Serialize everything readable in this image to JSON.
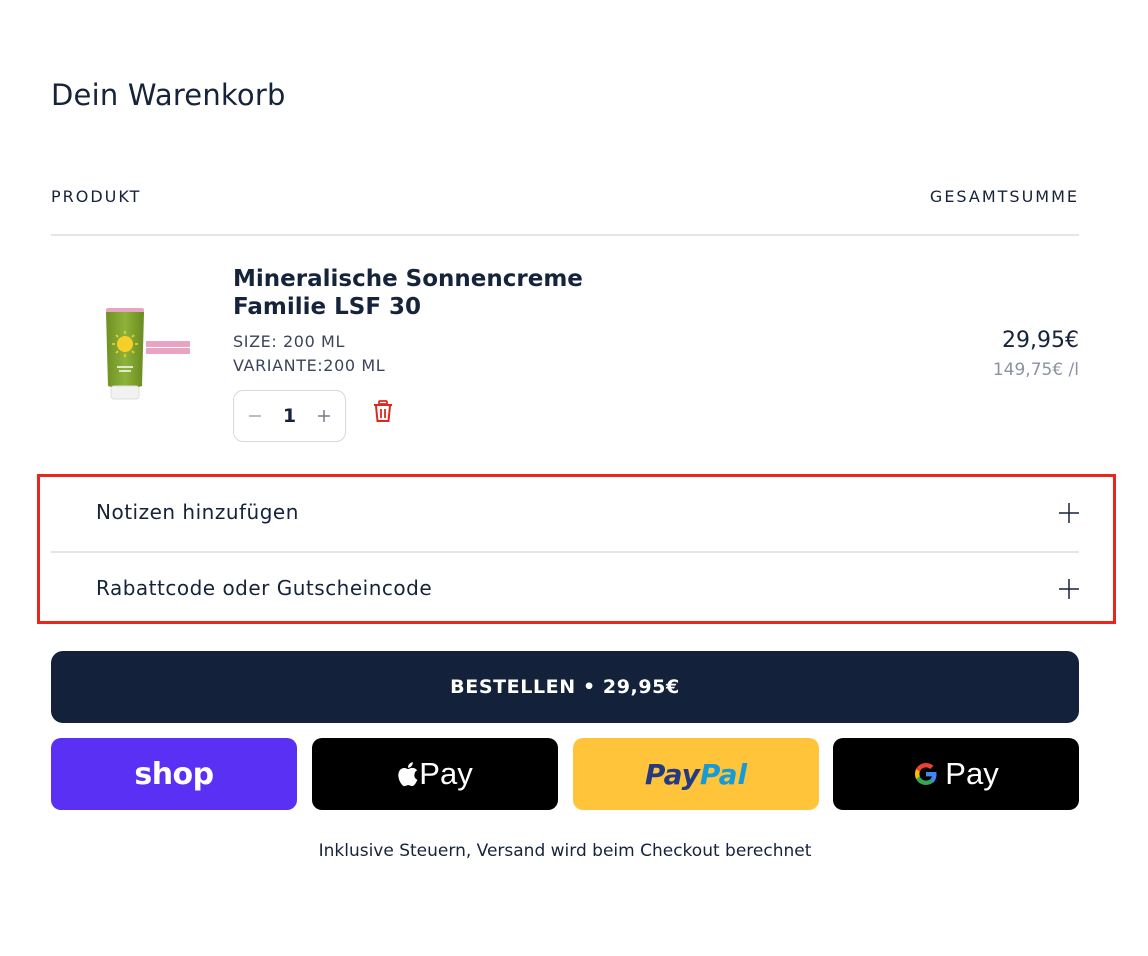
{
  "cart": {
    "title": "Dein Warenkorb",
    "col_product": "PRODUKT",
    "col_total": "GESAMTSUMME"
  },
  "item": {
    "name_line1": "Mineralische Sonnencreme",
    "name_line2": "Familie LSF 30",
    "size": "SIZE: 200 ML",
    "variant": "VARIANTE:200 ML",
    "quantity": "1",
    "price": "29,95€",
    "unit_price": "149,75€ /l",
    "image_icon": "sunscreen-tube-icon"
  },
  "accordion": {
    "notes_label": "Notizen hinzufügen",
    "discount_label": "Rabattcode oder Gutscheincode"
  },
  "checkout": {
    "button_label": "BESTELLEN • 29,95€"
  },
  "payments": {
    "shop": "shop",
    "apple_pay": "Pay",
    "paypal_a": "Pay",
    "paypal_b": "Pal",
    "google_pay": "Pay"
  },
  "footnote": "Inklusive Steuern, Versand wird beim Checkout berechnet",
  "colors": {
    "primary": "#13213a",
    "highlight": "#e8261a",
    "shop": "#5a31f4",
    "paypal": "#ffc439",
    "trash": "#e1261c"
  }
}
